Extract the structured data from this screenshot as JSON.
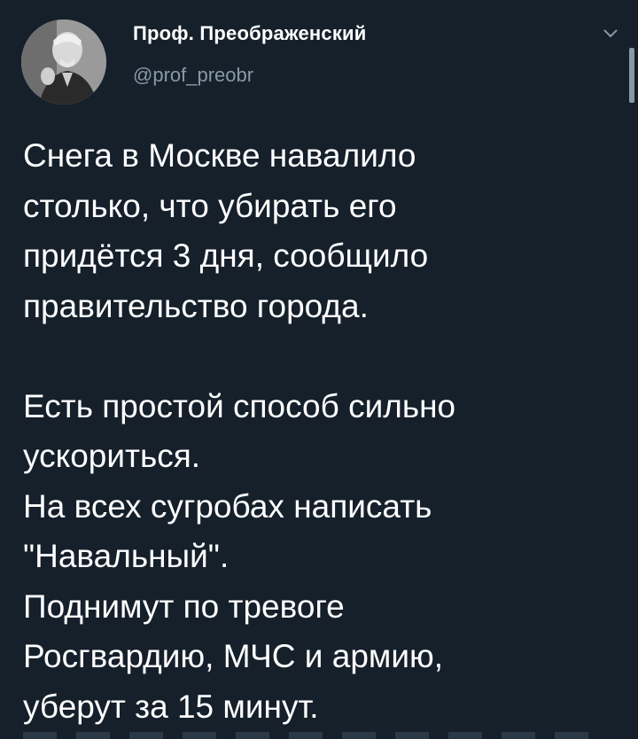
{
  "author": {
    "display_name": "Проф. Преображенский",
    "handle": "@prof_preobr"
  },
  "tweet": {
    "paragraph_1": [
      "Снега в Москве навалило",
      "столько, что убирать его",
      "придётся 3 дня, сообщило",
      "правительство города."
    ],
    "paragraph_2": [
      "Есть простой способ сильно",
      "ускориться.",
      "На всех сугробах написать",
      "\"Навальный\".",
      "Поднимут по тревоге",
      "Росгвардию, МЧС и армию,",
      "уберут за 15 минут."
    ]
  },
  "icons": {
    "menu": "chevron-down-icon"
  },
  "colors": {
    "background": "#15202b",
    "text": "#ffffff",
    "secondary_text": "#8899a6"
  }
}
